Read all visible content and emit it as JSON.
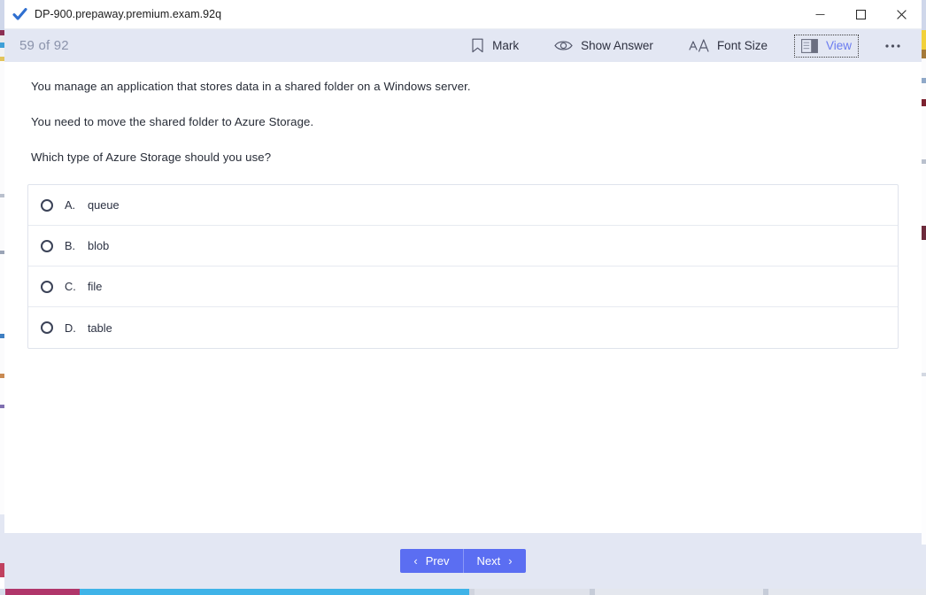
{
  "window": {
    "title": "DP-900.prepaway.premium.exam.92q",
    "app_icon": "blue-checkmark-icon",
    "controls": {
      "minimize": "minimize-icon",
      "maximize": "maximize-icon",
      "close": "close-icon"
    }
  },
  "toolbar": {
    "counter": "59 of 92",
    "items": [
      {
        "label": "Mark",
        "icon": "bookmark-icon",
        "focused": false,
        "accent": false
      },
      {
        "label": "Show Answer",
        "icon": "eye-icon",
        "focused": false,
        "accent": false
      },
      {
        "label": "Font Size",
        "icon": "font-size-icon",
        "focused": false,
        "accent": false
      },
      {
        "label": "View",
        "icon": "layout-panel-icon",
        "focused": true,
        "accent": true
      }
    ],
    "more_label": "more-options-icon"
  },
  "question": {
    "stem_lines": [
      "You manage an application that stores data in a shared folder on a Windows server.",
      "You need to move the shared folder to Azure Storage.",
      "Which type of Azure Storage should you use?"
    ],
    "options": [
      {
        "letter": "A.",
        "text": "queue",
        "selected": false
      },
      {
        "letter": "B.",
        "text": "blob",
        "selected": false
      },
      {
        "letter": "C.",
        "text": "file",
        "selected": false
      },
      {
        "letter": "D.",
        "text": "table",
        "selected": false
      }
    ]
  },
  "footer": {
    "prev_label": "Prev",
    "next_label": "Next",
    "prev_chevron": "‹",
    "next_chevron": "›"
  },
  "colors": {
    "toolbar_bg": "#e3e7f3",
    "accent_blue": "#6a7bf0",
    "nav_button": "#5b6ef2",
    "counter_text": "#8b93ab",
    "body_text": "#262b36"
  }
}
